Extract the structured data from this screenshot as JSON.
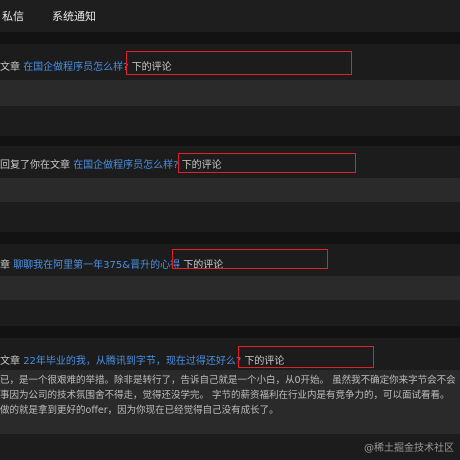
{
  "tabs": [
    {
      "label": "私信"
    },
    {
      "label": "系统通知"
    }
  ],
  "notifications": [
    {
      "prefix": "文章 ",
      "article": "在国企做程序员怎么样?",
      "suffix": "下的评论"
    },
    {
      "prefix": "回复了你在文章 ",
      "article": "在国企做程序员怎么样?",
      "suffix": "下的评论"
    },
    {
      "prefix": "章 ",
      "article": "聊聊我在阿里第一年375&晋升的心得",
      "suffix": "下的评论"
    },
    {
      "prefix": "文章 ",
      "article": "22年毕业的我，从腾讯到字节，现在过得还好么?",
      "suffix": "下的评论"
    }
  ],
  "comment_lines": [
    "已，是一个很艰难的举措。除非是转行了，告诉自己就是一个小白，从0开始。 虽然我不确定你来字节会不会",
    "事因为公司的技术氛围舍不得走，觉得还没学完。 字节的薪资福利在行业内是有竞争力的，可以面试看看。",
    "做的就是拿到更好的offer，因为你现在已经觉得自己没有成长了。"
  ],
  "watermark": "@稀土掘金技术社区"
}
